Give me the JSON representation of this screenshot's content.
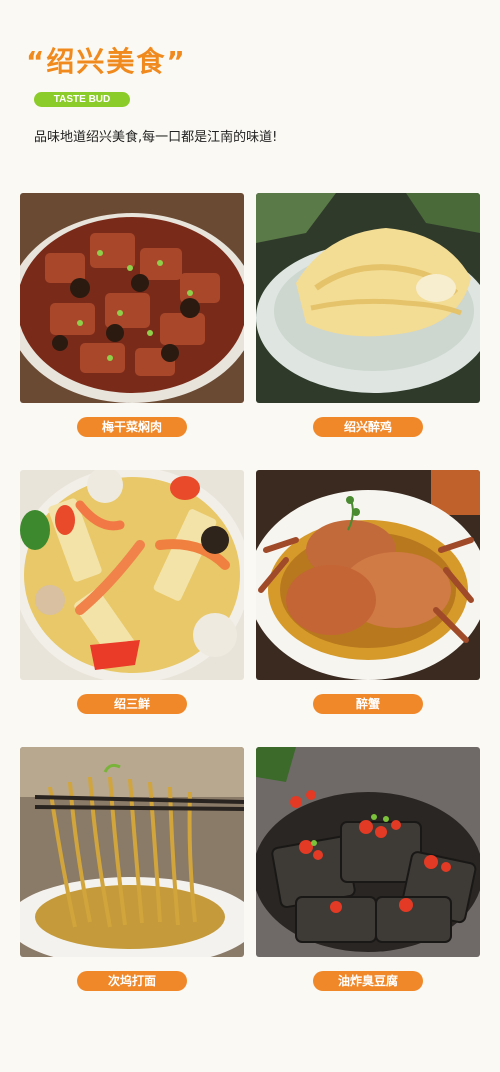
{
  "header": {
    "title": "“绍兴美食”",
    "badge": "TASTE BUD",
    "intro": "品味地道绍兴美食,每一口都是江南的味道!"
  },
  "dishes": [
    {
      "label": "梅干菜焖肉",
      "icon": "braised-pork-photo"
    },
    {
      "label": "绍兴醉鸡",
      "icon": "drunken-chicken-photo"
    },
    {
      "label": "绍三鲜",
      "icon": "seafood-stew-photo"
    },
    {
      "label": "醉蟹",
      "icon": "drunken-crab-photo"
    },
    {
      "label": "次坞打面",
      "icon": "noodles-photo"
    },
    {
      "label": "油炸臭豆腐",
      "icon": "fried-tofu-photo"
    }
  ],
  "colors": {
    "accent": "#f08a1e",
    "badge": "#8ccc2a",
    "label_bg": "#f0882a",
    "background": "#fbf9f3"
  }
}
